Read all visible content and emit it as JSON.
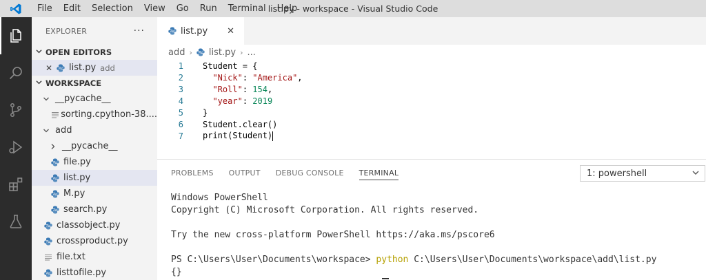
{
  "window": {
    "title": "list.py - workspace - Visual Studio Code",
    "menu": [
      "File",
      "Edit",
      "Selection",
      "View",
      "Go",
      "Run",
      "Terminal",
      "Help"
    ]
  },
  "activity_bar": {
    "icons": [
      "files-icon",
      "search-icon",
      "source-control-icon",
      "run-debug-icon",
      "extensions-icon",
      "testing-icon"
    ],
    "active": "files-icon"
  },
  "sidebar": {
    "title": "EXPLORER",
    "more": "···",
    "open_editors": {
      "label": "OPEN EDITORS",
      "items": [
        {
          "name": "list.py",
          "folder": "add"
        }
      ]
    },
    "workspace": {
      "label": "WORKSPACE",
      "tree": [
        {
          "name": "__pycache__",
          "kind": "folder",
          "level": 1,
          "expanded": true
        },
        {
          "name": "sorting.cpython-38....",
          "kind": "text",
          "level": 2
        },
        {
          "name": "add",
          "kind": "folder",
          "level": 1,
          "expanded": true
        },
        {
          "name": "__pycache__",
          "kind": "folder",
          "level": 2,
          "expanded": false
        },
        {
          "name": "file.py",
          "kind": "python",
          "level": 2
        },
        {
          "name": "list.py",
          "kind": "python",
          "level": 2,
          "selected": true
        },
        {
          "name": "M.py",
          "kind": "python",
          "level": 2
        },
        {
          "name": "search.py",
          "kind": "python",
          "level": 2
        },
        {
          "name": "classobject.py",
          "kind": "python",
          "level": 1
        },
        {
          "name": "crossproduct.py",
          "kind": "python",
          "level": 1
        },
        {
          "name": "file.txt",
          "kind": "text",
          "level": 1
        },
        {
          "name": "listtofile.py",
          "kind": "python",
          "level": 1
        }
      ]
    }
  },
  "editor": {
    "tab": {
      "label": "list.py",
      "close": "✕"
    },
    "breadcrumb": [
      "add",
      "list.py",
      "..."
    ],
    "lines": [
      [
        {
          "t": "Student = {",
          "c": ""
        }
      ],
      [
        {
          "t": "  ",
          "c": ""
        },
        {
          "t": "\"Nick\"",
          "c": "k"
        },
        {
          "t": ": ",
          "c": ""
        },
        {
          "t": "\"America\"",
          "c": "k"
        },
        {
          "t": ",",
          "c": ""
        }
      ],
      [
        {
          "t": "  ",
          "c": ""
        },
        {
          "t": "\"Roll\"",
          "c": "k"
        },
        {
          "t": ": ",
          "c": ""
        },
        {
          "t": "154",
          "c": "n"
        },
        {
          "t": ",",
          "c": ""
        }
      ],
      [
        {
          "t": "  ",
          "c": ""
        },
        {
          "t": "\"year\"",
          "c": "k"
        },
        {
          "t": ": ",
          "c": ""
        },
        {
          "t": "2019",
          "c": "n"
        }
      ],
      [
        {
          "t": "}",
          "c": ""
        }
      ],
      [
        {
          "t": "Student.clear()",
          "c": ""
        }
      ],
      [
        {
          "t": "print(Student)",
          "c": ""
        }
      ]
    ]
  },
  "panel": {
    "tabs": [
      "PROBLEMS",
      "OUTPUT",
      "DEBUG CONSOLE",
      "TERMINAL"
    ],
    "active_tab": "TERMINAL",
    "terminal_selector": "1: powershell",
    "terminal": {
      "line1": "Windows PowerShell",
      "line2": "Copyright (C) Microsoft Corporation. All rights reserved.",
      "line3": "",
      "line4": "Try the new cross-platform PowerShell https://aka.ms/pscore6",
      "line5": "",
      "prompt": "PS C:\\Users\\User\\Documents\\workspace> ",
      "cmd": "python",
      "args": " C:\\Users\\User\\Documents\\workspace\\add\\list.py",
      "output": "{}"
    }
  },
  "colors": {
    "activity_bar": "#2c2c2c",
    "sidebar": "#f3f3f3",
    "title_bar": "#dddddd",
    "string": "#a31515",
    "number": "#098658",
    "line_number": "#237893",
    "python_icon": "#3c7bb5",
    "vscode_blue": "#0078d4"
  }
}
